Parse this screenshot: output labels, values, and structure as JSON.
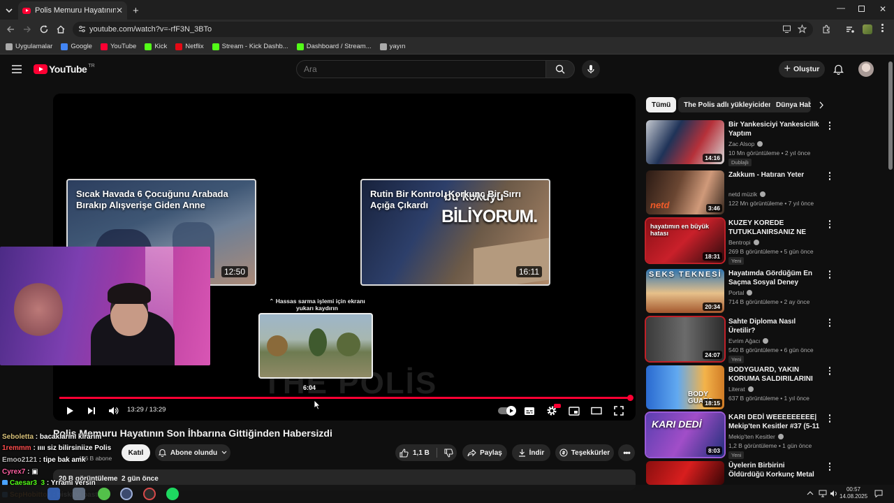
{
  "browser": {
    "tab_title": "Polis Memuru Hayatının Son İhb",
    "url": "youtube.com/watch?v=-rfF3N_3BTo",
    "bookmarks": [
      {
        "label": "Uygulamalar",
        "color": "#aaaaaa"
      },
      {
        "label": "Google",
        "color": "#4285f4"
      },
      {
        "label": "YouTube",
        "color": "#ff0033"
      },
      {
        "label": "Kick",
        "color": "#53fc18"
      },
      {
        "label": "Netflix",
        "color": "#e50914"
      },
      {
        "label": "Stream - Kick Dashb...",
        "color": "#53fc18"
      },
      {
        "label": "Dashboard / Stream...",
        "color": "#53fc18"
      },
      {
        "label": "yayın",
        "color": "#aaaaaa"
      }
    ]
  },
  "header": {
    "logo_text": "YouTube",
    "logo_country": "TR",
    "search_placeholder": "Ara",
    "create_label": "Oluştur"
  },
  "player": {
    "endcards": [
      {
        "title": "Sıcak Havada 6 Çocuğunu Arabada Bırakıp Alışverişe Giden Anne",
        "duration": "12:50"
      },
      {
        "title": "Rutin Bir Kontrol, Korkunç Bir Sırrı Açığa Çıkardı",
        "duration": "16:11",
        "overlay_top": "bu kokuyu",
        "overlay_big": "BİLİYORUM."
      }
    ],
    "scroll_hint": "Hassas sarma işlemi için ekranı yukarı kaydırın",
    "scrub_time": "6:04",
    "watermark": "THE POLİS",
    "time_display": "13:29 / 13:29",
    "progress": 1.0
  },
  "video": {
    "title": "Polis Memuru Hayatının Son İhbarına Gittiğinden Habersizdi",
    "subscribers": "436 B abone",
    "join_label": "Katıl",
    "subscribed_label": "Abone olundu",
    "likes": "1,1 B",
    "share_label": "Paylaş",
    "download_label": "İndir",
    "thanks_label": "Teşekkürler",
    "views_line": "20 B görüntüleme  2 gün önce"
  },
  "sidebar": {
    "chips": [
      "Tümü",
      "The Polis adlı yükleyiciden",
      "Dünya Hab"
    ],
    "recommendations": [
      {
        "title": "Bir Yankesiciyi Yankesicilik Yaptım",
        "channel": "Zac Alsop",
        "meta": "10 Mn görüntüleme • 2 yıl önce",
        "badge": "Dublajlı",
        "duration": "14:16"
      },
      {
        "title": "Zakkum - Hatıran Yeter",
        "channel": "netd müzik",
        "meta": "122 Mn görüntüleme • 7 yıl önce",
        "badge": "",
        "duration": "3:46",
        "thumb_text": "netd"
      },
      {
        "title": "KUZEY KOREDE TUTUKLANIRSANIZ NE OLUR?",
        "channel": "Bentropi",
        "meta": "269 B görüntüleme • 5 gün önce",
        "badge": "Yeni",
        "duration": "18:31",
        "thumb_text": "hayatımın en büyük hatası"
      },
      {
        "title": "Hayatımda Gördüğüm En Saçma Sosyal Deney",
        "channel": "Portal",
        "meta": "714 B görüntüleme • 2 ay önce",
        "badge": "",
        "duration": "20:34",
        "thumb_text": "SEKS TEKNESİ"
      },
      {
        "title": "Sahte Diploma Nasıl Üretilir?",
        "channel": "Evrim Ağacı",
        "meta": "540 B görüntüleme • 6 gün önce",
        "badge": "Yeni",
        "duration": "24:07"
      },
      {
        "title": "BODYGUARD, YAKIN KORUMA SALDIRILARINI İZLİYOR!",
        "channel": "Literat",
        "meta": "637 B görüntüleme • 1 yıl önce",
        "badge": "",
        "duration": "18:15",
        "thumb_text": "BODY GUARD"
      },
      {
        "title": "KARI DEDİ WEEEEEEEEE| Mekip'ten Kesitler #37 (5-11 ...",
        "channel": "Mekip'ten Kesitler",
        "meta": "1,2 B görüntüleme • 1 gün önce",
        "badge": "Yeni",
        "duration": "8:03",
        "thumb_text": "KARI DEDİ"
      },
      {
        "title": "Üyelerin Birbirini Öldürdüğü Korkunç Metal Grubu",
        "channel": "",
        "meta": "",
        "badge": "",
        "duration": ""
      }
    ]
  },
  "chat": [
    {
      "user": "Seboletta",
      "msg": "bacaklarını kırarım",
      "color": "#d9c27a"
    },
    {
      "user": "1remmm",
      "msg": "ıııı siz bilirsiniize Polis",
      "color": "#ff4d4d"
    },
    {
      "user": "Emoo2121",
      "msg": "tipe bak amk",
      "color": "#bbbbbb"
    },
    {
      "user": "Cyrex7",
      "msg": "▣",
      "color": "#ff5fa2"
    },
    {
      "user": "Caesar3_3",
      "msg": "Yrrami yersin",
      "color": "#53fc18"
    },
    {
      "user": "ScpHobittox",
      "msg": "bisküvi pastası",
      "color": "#ff9b2f"
    }
  ],
  "taskbar": {
    "time": "00:57",
    "date": "14.08.2025"
  }
}
